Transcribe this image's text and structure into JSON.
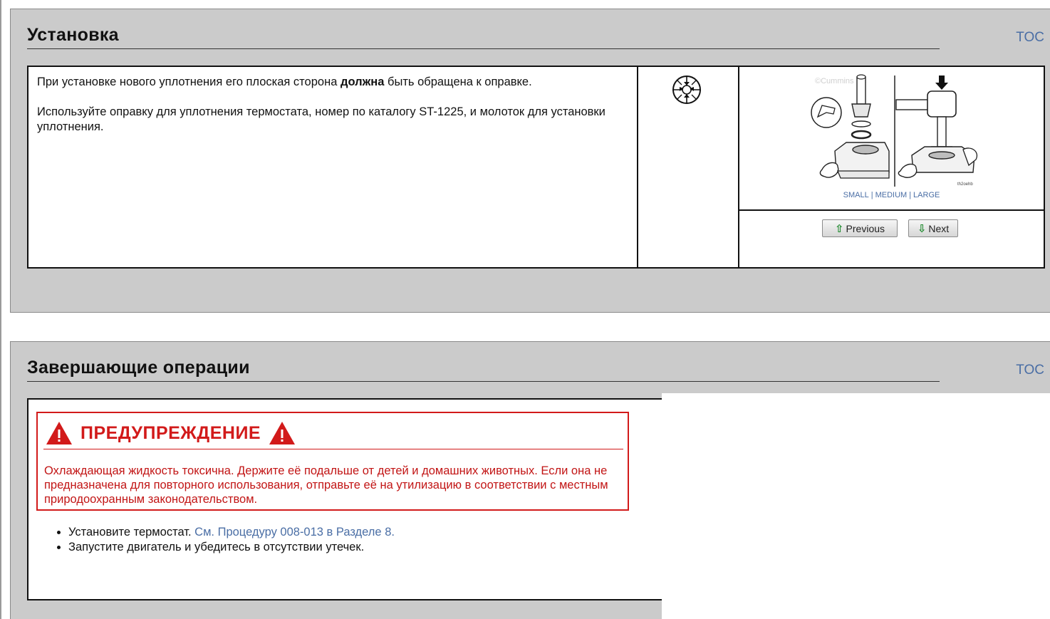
{
  "sections": [
    {
      "title": "Установка",
      "toc": "TOC",
      "text": {
        "p1_before": "При установке нового уплотнения его плоская сторона ",
        "p1_bold": "должна",
        "p1_after": " быть обращена к оправке.",
        "p2": "Используйте оправку для уплотнения термостата, номер по каталогу ST-1225, и молоток для установки уплотнения."
      },
      "icon": "tool-compass-icon",
      "figure": {
        "copyright": "©Cummins Inc",
        "code": "th2oehb",
        "size_links": [
          "SMALL",
          "MEDIUM",
          "LARGE"
        ],
        "separator": "|"
      },
      "nav": {
        "previous": "Previous",
        "next": "Next"
      }
    },
    {
      "title": "Завершающие операции",
      "toc": "TOC",
      "warning": {
        "title": "ПРЕДУПРЕЖДЕНИЕ",
        "text": "Охлаждающая жидкость токсична. Держите её подальше от детей и домашних животных. Если она не предназначена для повторного использования, отправьте её на утилизацию в соответствии с местным природоохранным законодательством."
      },
      "steps": [
        {
          "text": "Установите термостат. ",
          "link": "См. Процедуру 008-013 в Разделе 8."
        },
        {
          "text": "Запустите двигатель и убедитесь в отсутствии утечек.",
          "link": ""
        }
      ]
    }
  ],
  "colors": {
    "panel": "#cbcbcb",
    "link": "#4a6ea5",
    "warning": "#d21a1a",
    "nav_arrow": "#1f8a2e"
  }
}
